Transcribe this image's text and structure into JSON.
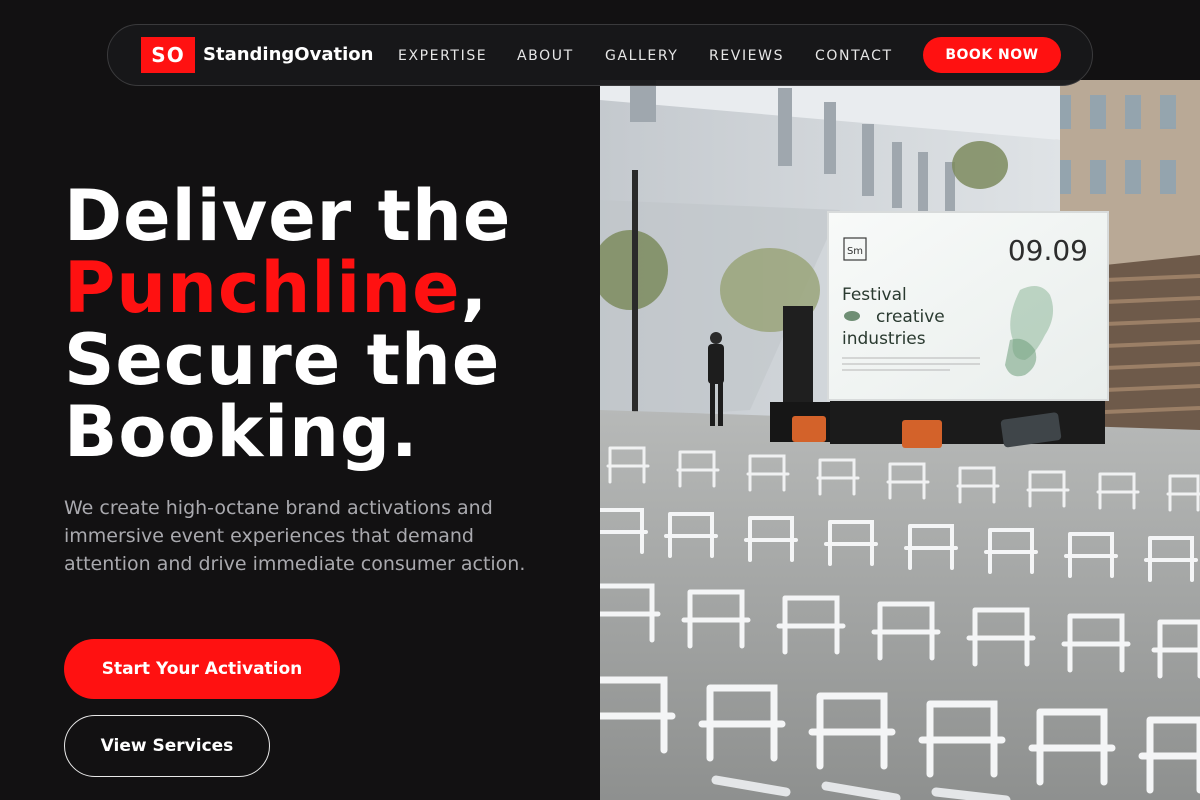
{
  "brand": {
    "badge": "SO",
    "name": "StandingOvation",
    "accent_color": "#ff1111"
  },
  "nav": {
    "links": [
      "EXPERTISE",
      "ABOUT",
      "GALLERY",
      "REVIEWS",
      "CONTACT"
    ],
    "cta": "BOOK NOW"
  },
  "hero": {
    "headline": {
      "line1": "Deliver the",
      "accent": "Punchline",
      "accent_suffix": ",",
      "line3": "Secure the",
      "line4": "Booking."
    },
    "description": "We create high-octane brand activations and immersive event experiences that demand attention and drive immediate consumer action.",
    "primary_button": "Start Your Activation",
    "secondary_button": "View Services"
  },
  "photo": {
    "screen_logo": "Sm",
    "screen_date": "09.09",
    "screen_title_1": "Festival",
    "screen_title_2": "creative",
    "screen_title_3": "industries"
  }
}
